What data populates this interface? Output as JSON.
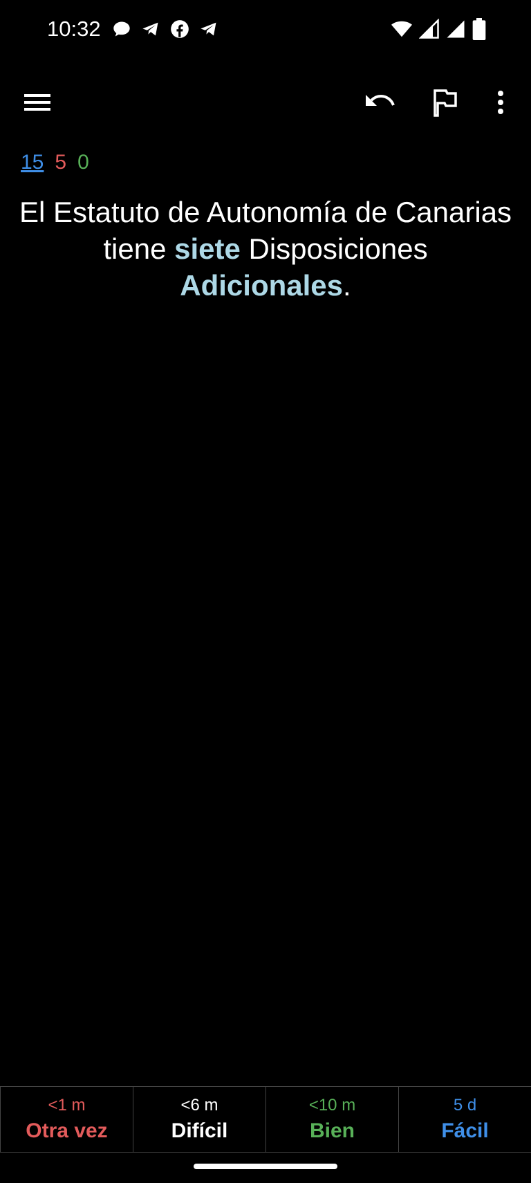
{
  "status_bar": {
    "time": "10:32",
    "left_icons": [
      "chat-bubble-icon",
      "telegram-icon",
      "facebook-icon",
      "telegram-icon"
    ],
    "right_icons": [
      "wifi-icon",
      "signal-icon",
      "signal-icon",
      "battery-icon"
    ]
  },
  "toolbar": {
    "icons": [
      "menu-icon",
      "undo-icon",
      "flag-icon",
      "more-vert-icon"
    ]
  },
  "counts": {
    "new": "15",
    "learning": "5",
    "review": "0"
  },
  "card": {
    "part1": "El Estatuto de Autonomía de Canarias tiene ",
    "highlight1": "siete",
    "part2": " Disposiciones ",
    "highlight2": "Adicionales",
    "part3": "."
  },
  "answer_buttons": [
    {
      "time": "<1 m",
      "label": "Otra vez",
      "color": "#e35b5b"
    },
    {
      "time": "<6 m",
      "label": "Difícil",
      "color": "#ffffff"
    },
    {
      "time": "<10 m",
      "label": "Bien",
      "color": "#58b058"
    },
    {
      "time": "5 d",
      "label": "Fácil",
      "color": "#3f8fe8"
    }
  ],
  "colors": {
    "background": "#000000",
    "highlight": "#add8e6"
  }
}
